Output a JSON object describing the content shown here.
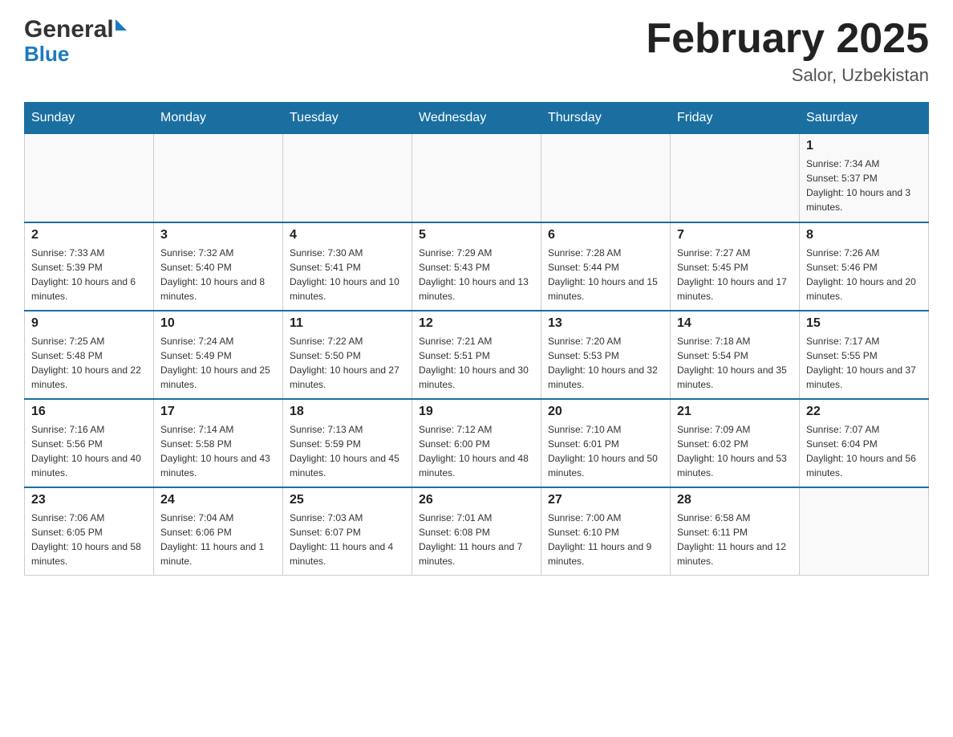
{
  "header": {
    "logo_general": "General",
    "logo_blue": "Blue",
    "month_title": "February 2025",
    "location": "Salor, Uzbekistan"
  },
  "days_of_week": [
    "Sunday",
    "Monday",
    "Tuesday",
    "Wednesday",
    "Thursday",
    "Friday",
    "Saturday"
  ],
  "weeks": [
    {
      "days": [
        {
          "num": "",
          "info": ""
        },
        {
          "num": "",
          "info": ""
        },
        {
          "num": "",
          "info": ""
        },
        {
          "num": "",
          "info": ""
        },
        {
          "num": "",
          "info": ""
        },
        {
          "num": "",
          "info": ""
        },
        {
          "num": "1",
          "info": "Sunrise: 7:34 AM\nSunset: 5:37 PM\nDaylight: 10 hours and 3 minutes."
        }
      ]
    },
    {
      "days": [
        {
          "num": "2",
          "info": "Sunrise: 7:33 AM\nSunset: 5:39 PM\nDaylight: 10 hours and 6 minutes."
        },
        {
          "num": "3",
          "info": "Sunrise: 7:32 AM\nSunset: 5:40 PM\nDaylight: 10 hours and 8 minutes."
        },
        {
          "num": "4",
          "info": "Sunrise: 7:30 AM\nSunset: 5:41 PM\nDaylight: 10 hours and 10 minutes."
        },
        {
          "num": "5",
          "info": "Sunrise: 7:29 AM\nSunset: 5:43 PM\nDaylight: 10 hours and 13 minutes."
        },
        {
          "num": "6",
          "info": "Sunrise: 7:28 AM\nSunset: 5:44 PM\nDaylight: 10 hours and 15 minutes."
        },
        {
          "num": "7",
          "info": "Sunrise: 7:27 AM\nSunset: 5:45 PM\nDaylight: 10 hours and 17 minutes."
        },
        {
          "num": "8",
          "info": "Sunrise: 7:26 AM\nSunset: 5:46 PM\nDaylight: 10 hours and 20 minutes."
        }
      ]
    },
    {
      "days": [
        {
          "num": "9",
          "info": "Sunrise: 7:25 AM\nSunset: 5:48 PM\nDaylight: 10 hours and 22 minutes."
        },
        {
          "num": "10",
          "info": "Sunrise: 7:24 AM\nSunset: 5:49 PM\nDaylight: 10 hours and 25 minutes."
        },
        {
          "num": "11",
          "info": "Sunrise: 7:22 AM\nSunset: 5:50 PM\nDaylight: 10 hours and 27 minutes."
        },
        {
          "num": "12",
          "info": "Sunrise: 7:21 AM\nSunset: 5:51 PM\nDaylight: 10 hours and 30 minutes."
        },
        {
          "num": "13",
          "info": "Sunrise: 7:20 AM\nSunset: 5:53 PM\nDaylight: 10 hours and 32 minutes."
        },
        {
          "num": "14",
          "info": "Sunrise: 7:18 AM\nSunset: 5:54 PM\nDaylight: 10 hours and 35 minutes."
        },
        {
          "num": "15",
          "info": "Sunrise: 7:17 AM\nSunset: 5:55 PM\nDaylight: 10 hours and 37 minutes."
        }
      ]
    },
    {
      "days": [
        {
          "num": "16",
          "info": "Sunrise: 7:16 AM\nSunset: 5:56 PM\nDaylight: 10 hours and 40 minutes."
        },
        {
          "num": "17",
          "info": "Sunrise: 7:14 AM\nSunset: 5:58 PM\nDaylight: 10 hours and 43 minutes."
        },
        {
          "num": "18",
          "info": "Sunrise: 7:13 AM\nSunset: 5:59 PM\nDaylight: 10 hours and 45 minutes."
        },
        {
          "num": "19",
          "info": "Sunrise: 7:12 AM\nSunset: 6:00 PM\nDaylight: 10 hours and 48 minutes."
        },
        {
          "num": "20",
          "info": "Sunrise: 7:10 AM\nSunset: 6:01 PM\nDaylight: 10 hours and 50 minutes."
        },
        {
          "num": "21",
          "info": "Sunrise: 7:09 AM\nSunset: 6:02 PM\nDaylight: 10 hours and 53 minutes."
        },
        {
          "num": "22",
          "info": "Sunrise: 7:07 AM\nSunset: 6:04 PM\nDaylight: 10 hours and 56 minutes."
        }
      ]
    },
    {
      "days": [
        {
          "num": "23",
          "info": "Sunrise: 7:06 AM\nSunset: 6:05 PM\nDaylight: 10 hours and 58 minutes."
        },
        {
          "num": "24",
          "info": "Sunrise: 7:04 AM\nSunset: 6:06 PM\nDaylight: 11 hours and 1 minute."
        },
        {
          "num": "25",
          "info": "Sunrise: 7:03 AM\nSunset: 6:07 PM\nDaylight: 11 hours and 4 minutes."
        },
        {
          "num": "26",
          "info": "Sunrise: 7:01 AM\nSunset: 6:08 PM\nDaylight: 11 hours and 7 minutes."
        },
        {
          "num": "27",
          "info": "Sunrise: 7:00 AM\nSunset: 6:10 PM\nDaylight: 11 hours and 9 minutes."
        },
        {
          "num": "28",
          "info": "Sunrise: 6:58 AM\nSunset: 6:11 PM\nDaylight: 11 hours and 12 minutes."
        },
        {
          "num": "",
          "info": ""
        }
      ]
    }
  ]
}
